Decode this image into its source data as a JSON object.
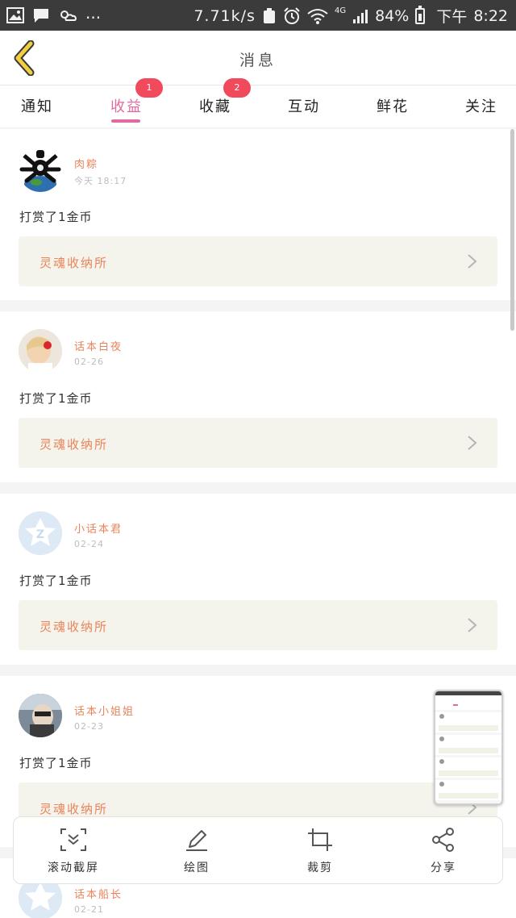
{
  "status_bar": {
    "net_speed": "7.71k/s",
    "network": "4G",
    "battery": "84%",
    "time_period": "下午",
    "time": "8:22",
    "ellipsis": "..."
  },
  "header": {
    "title": "消息"
  },
  "tabs": [
    {
      "label": "通知"
    },
    {
      "label": "收益",
      "badge": "1"
    },
    {
      "label": "收藏",
      "badge": "2"
    },
    {
      "label": "互动"
    },
    {
      "label": "鲜花"
    },
    {
      "label": "关注"
    }
  ],
  "feed": [
    {
      "user": "肉粽",
      "time": "今天 18:17",
      "message": "打赏了1金币",
      "link": "灵魂收纳所"
    },
    {
      "user": "话本白夜",
      "time": "02-26",
      "message": "打赏了1金币",
      "link": "灵魂收纳所"
    },
    {
      "user": "小话本君",
      "time": "02-24",
      "message": "打赏了1金币",
      "link": "灵魂收纳所"
    },
    {
      "user": "话本小姐姐",
      "time": "02-23",
      "message": "打赏了1金币",
      "link": "灵魂收纳所"
    },
    {
      "user": "话本船长",
      "time": "02-21"
    }
  ],
  "toolbar": {
    "scroll_capture": "滚动截屏",
    "draw": "绘图",
    "crop": "裁剪",
    "share": "分享"
  },
  "colors": {
    "accent": "#e26aa0",
    "link": "#e9845a",
    "badge": "#f04a5c",
    "back_arrow": "#f1cf3f"
  }
}
